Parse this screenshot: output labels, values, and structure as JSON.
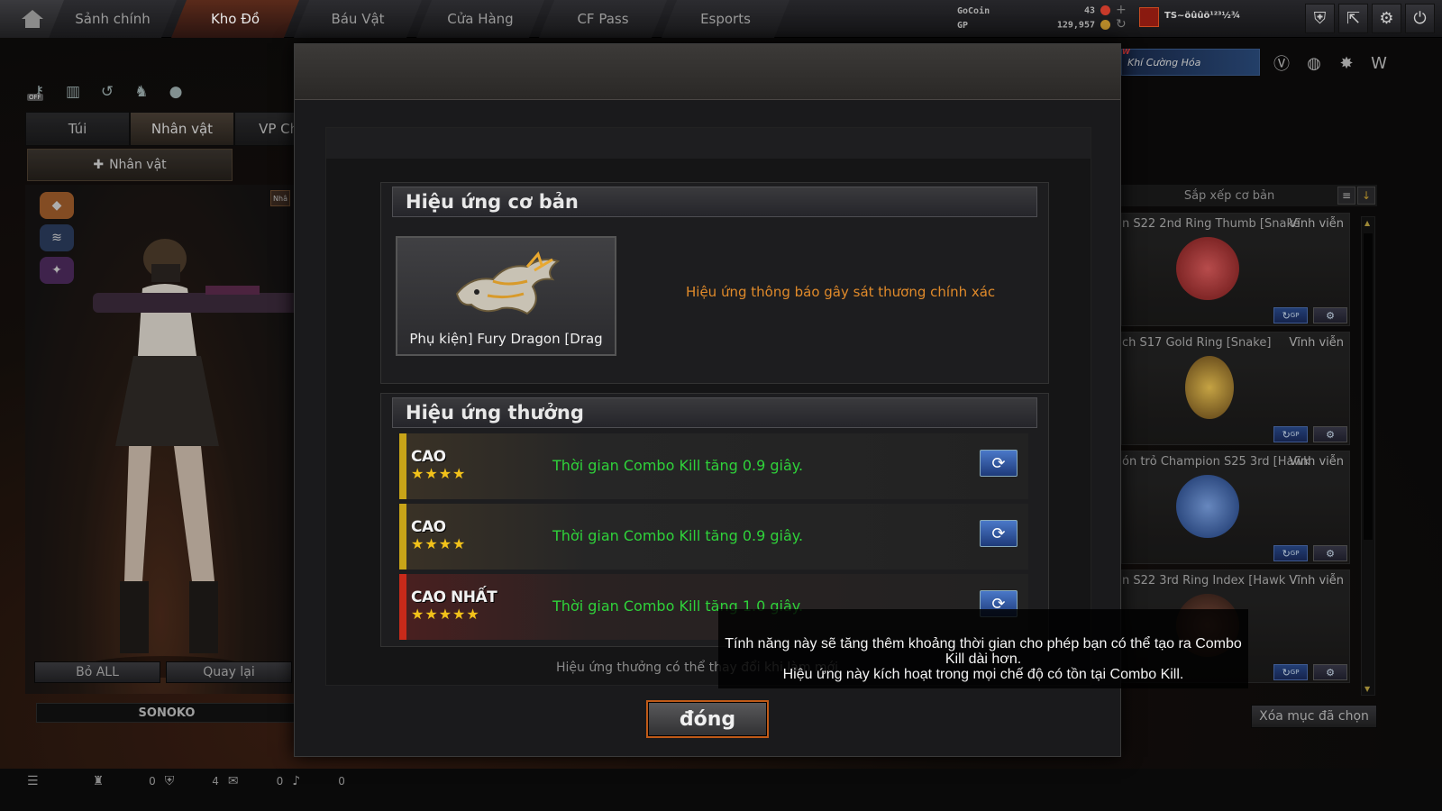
{
  "nav": {
    "tabs": [
      "Sảnh chính",
      "Kho Đồ",
      "Báu Vật",
      "Cửa Hàng",
      "CF Pass",
      "Esports"
    ],
    "active_index": 1
  },
  "currency": {
    "gocoin_label": "GoCoin",
    "gocoin_value": "43",
    "gp_label": "GP",
    "gp_value": "129,957"
  },
  "player": {
    "name": "TS~öûûö¹²³½¾"
  },
  "left_panel": {
    "tabs": [
      "Túi",
      "Nhân vật",
      "VP Chức"
    ],
    "active_tab": 1,
    "sub_tab": "Nhân vật",
    "side_label": "Nhâ",
    "remove_all": "Bỏ ALL",
    "back": "Quay lại",
    "character_name": "SONOKO"
  },
  "right_panel": {
    "banner_tag": "W",
    "banner_text": "Khí Cường Hóa",
    "sort_label": "Sắp xếp cơ bản",
    "items": [
      {
        "name": "n S22 2nd Ring Thumb [Snake",
        "perm": "Vĩnh viễn",
        "color": "#b83a3a"
      },
      {
        "name": "ch S17 Gold Ring [Snake]",
        "perm": "Vĩnh viễn",
        "color": "#c8a030"
      },
      {
        "name": "ón trỏ Champion S25 3rd [Hawk",
        "perm": "Vĩnh viễn",
        "color": "#3a6ab8"
      },
      {
        "name": "n S22 3rd Ring Index [Hawk",
        "perm": "Vĩnh viễn",
        "color": "#5a3a30"
      }
    ],
    "gp_btn": "GP",
    "delete_selected": "Xóa mục đã chọn"
  },
  "bottom": {
    "counts": [
      "0",
      "4",
      "0",
      "0"
    ]
  },
  "modal": {
    "basic_title": "Hiệu ứng cơ bản",
    "item_name": "Phụ kiện] Fury Dragon [Drag",
    "basic_effect": "Hiệu ứng thông báo gây sát thương chính xác",
    "bonus_title": "Hiệu ứng thưởng",
    "bonus_rows": [
      {
        "tier": "CAO",
        "stars": "★★★★",
        "text": "Thời gian Combo Kill tăng 0.9 giây.",
        "bar_color": "#c8a418"
      },
      {
        "tier": "CAO",
        "stars": "★★★★",
        "text": "Thời gian Combo Kill tăng 0.9 giây.",
        "bar_color": "#c8a418"
      },
      {
        "tier": "CAO NHẤT",
        "stars": "★★★★★",
        "text": "Thời gian Combo Kill tăng 1.0 giây.",
        "bar_color": "#c82a1a"
      }
    ],
    "note": "Hiệu ứng thưởng có thể thay đổi khi làm mới",
    "close": "đóng"
  },
  "tooltip": {
    "line1": "Tính năng này sẽ tăng thêm khoảng thời gian cho phép bạn có thể tạo ra Combo Kill dài hơn.",
    "line2": "Hiệu ứng này kích hoạt trong mọi chế độ có tồn tại Combo Kill."
  },
  "colors": {
    "accent_orange": "#c05a18",
    "effect_orange": "#e08a2a",
    "bonus_green": "#2fd23a",
    "star_gold": "#f2c21a"
  }
}
